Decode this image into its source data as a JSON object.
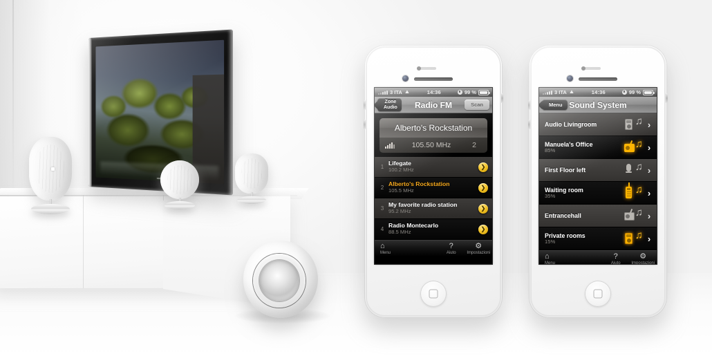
{
  "scene": {
    "description": "Modern living room with wall-mounted flat TV, white speakers and a white sideboard",
    "tv_content": "trees"
  },
  "phone_left": {
    "statusbar": {
      "carrier": "3 ITA",
      "time": "14:36",
      "battery": "99 %",
      "signal_icon": "signal-bars-icon",
      "wifi_icon": "wifi-icon",
      "lock_icon": "rotation-lock-icon",
      "battery_icon": "battery-icon"
    },
    "navbar": {
      "back_line1": "Zone",
      "back_line2": "Audio",
      "title": "Radio FM",
      "action": "Scan"
    },
    "now_playing": {
      "station": "Alberto's Rockstation",
      "frequency": "105.50 MHz",
      "preset": "2",
      "signal_icon": "signal-strength-icon"
    },
    "stations": [
      {
        "index": "1",
        "name": "Lifegate",
        "frequency": "100.2 MHz",
        "active": false
      },
      {
        "index": "2",
        "name": "Alberto's Rockstation",
        "frequency": "105.5 MHz",
        "active": true
      },
      {
        "index": "3",
        "name": "My favorite radio station",
        "frequency": "95.2 MHz",
        "active": false
      },
      {
        "index": "4",
        "name": "Radio Montecarlo",
        "frequency": "88.5 MHz",
        "active": false
      }
    ],
    "tabbar": [
      {
        "icon": "home-icon",
        "glyph": "⌂",
        "label": "Menu"
      },
      {
        "icon": "help-icon",
        "glyph": "?",
        "label": "Aiuto"
      },
      {
        "icon": "gear-icon",
        "glyph": "⚙",
        "label": "Impostazioni"
      }
    ]
  },
  "phone_right": {
    "statusbar": {
      "carrier": "3 ITA",
      "time": "14:36",
      "battery": "99 %",
      "signal_icon": "signal-bars-icon",
      "wifi_icon": "wifi-icon",
      "lock_icon": "rotation-lock-icon",
      "battery_icon": "battery-icon"
    },
    "navbar": {
      "back": "Menu",
      "title": "Sound System"
    },
    "zones": [
      {
        "name": "Audio Livingroom",
        "percent": "",
        "source": "ipod",
        "active": false
      },
      {
        "name": "Manuela's Office",
        "percent": "85%",
        "source": "radio",
        "active": true
      },
      {
        "name": "First Floor left",
        "percent": "",
        "source": "mic",
        "active": false
      },
      {
        "name": "Waiting room",
        "percent": "35%",
        "source": "remote",
        "active": true
      },
      {
        "name": "Entrancehall",
        "percent": "",
        "source": "radio",
        "active": false
      },
      {
        "name": "Private rooms",
        "percent": "15%",
        "source": "ipod",
        "active": true
      }
    ],
    "chevron": "›",
    "tabbar": [
      {
        "icon": "home-icon",
        "glyph": "⌂",
        "label": "Menu"
      },
      {
        "icon": "help-icon",
        "glyph": "?",
        "label": "Aiuto"
      },
      {
        "icon": "gear-icon",
        "glyph": "⚙",
        "label": "Impostazioni"
      }
    ]
  },
  "colors": {
    "accent_yellow": "#f5a81c",
    "glow_yellow": "#ffb500",
    "screen_black": "#000000",
    "row_gray": "#3d3b39"
  }
}
